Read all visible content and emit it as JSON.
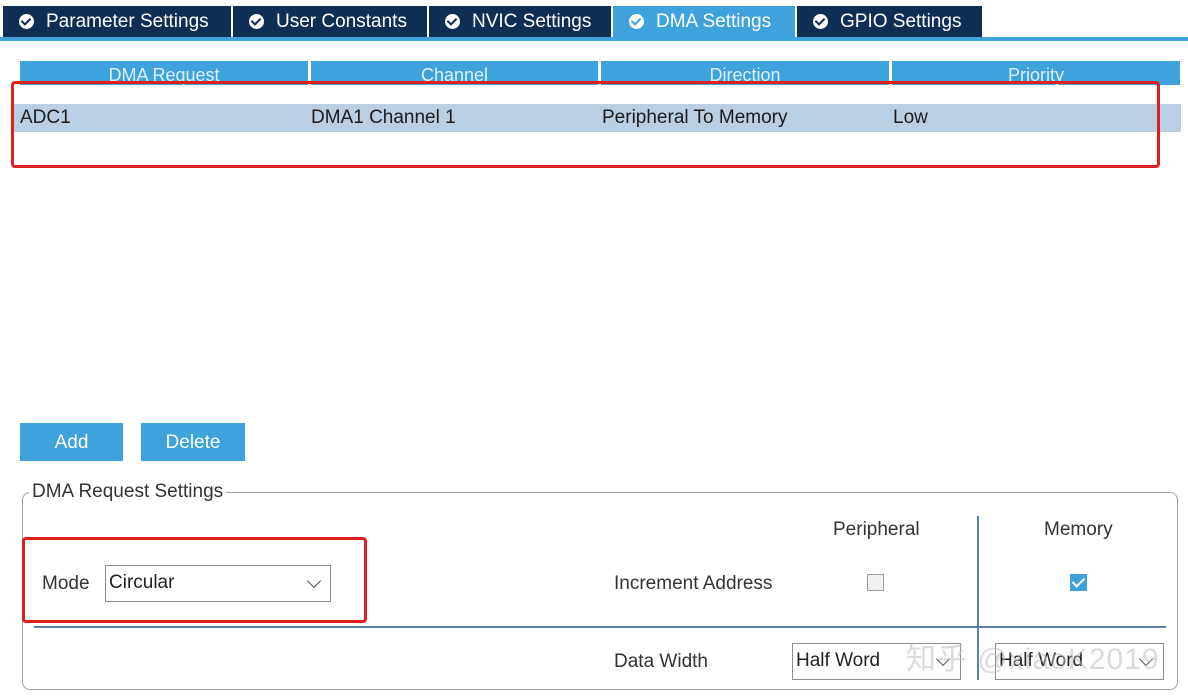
{
  "tabs": [
    {
      "label": "Parameter Settings",
      "active": false
    },
    {
      "label": "User Constants",
      "active": false
    },
    {
      "label": "NVIC Settings",
      "active": false
    },
    {
      "label": "DMA Settings",
      "active": true
    },
    {
      "label": "GPIO Settings",
      "active": false
    }
  ],
  "table": {
    "columns": [
      "DMA Request",
      "Channel",
      "Direction",
      "Priority"
    ],
    "rows": [
      {
        "request": "ADC1",
        "channel": "DMA1 Channel 1",
        "direction": "Peripheral To Memory",
        "priority": "Low"
      }
    ]
  },
  "buttons": {
    "add": "Add",
    "delete": "Delete"
  },
  "settings": {
    "title": "DMA Request Settings",
    "mode_label": "Mode",
    "mode_value": "Circular",
    "col_peripheral": "Peripheral",
    "col_memory": "Memory",
    "increment_label": "Increment Address",
    "increment_peripheral": false,
    "increment_memory": true,
    "data_width_label": "Data Width",
    "data_width_peripheral": "Half Word",
    "data_width_memory": "Half Word"
  },
  "watermark": "知乎 @xiaoK2019",
  "colors": {
    "accent": "#3ea2dc",
    "tab_dark": "#0e2f53",
    "selection": "#b8cfe4",
    "highlight": "#e02020"
  }
}
